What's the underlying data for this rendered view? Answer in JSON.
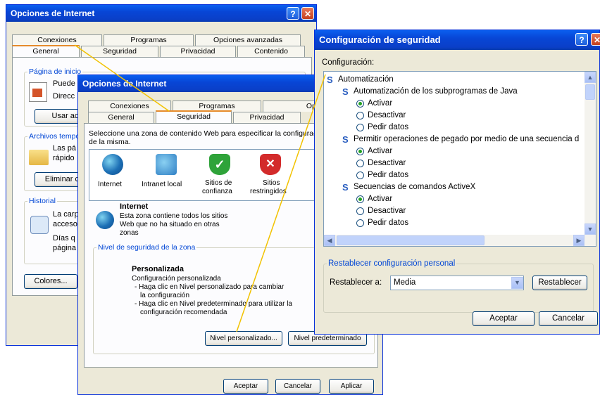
{
  "win1": {
    "title": "Opciones de Internet",
    "tabs_top": [
      "Conexiones",
      "Programas",
      "Opciones avanzadas"
    ],
    "tabs_bottom": [
      "General",
      "Seguridad",
      "Privacidad",
      "Contenido"
    ],
    "group_home": "Página de inicio",
    "home_text1": "Puede",
    "home_text2": "Direcc",
    "btn_use_current": "Usar act",
    "group_temp": "Archivos tempor",
    "temp_text1": "Las pá",
    "temp_text2": "rápido",
    "btn_delete": "Eliminar coo",
    "group_history": "Historial",
    "hist_text1": "La carp",
    "hist_text2": "acceso",
    "hist_text3": "Días q",
    "hist_text4": "página",
    "btn_colors": "Colores..."
  },
  "win2": {
    "title": "Opciones de Internet",
    "tabs_top": [
      "Conexiones",
      "Programas",
      "Opciones"
    ],
    "tabs_bottom": [
      "General",
      "Seguridad",
      "Privacidad"
    ],
    "intro": "Seleccione una zona de contenido Web para especificar la configuració",
    "intro2": "de la misma.",
    "zones": [
      {
        "label": "Internet",
        "icon": "globe-icon"
      },
      {
        "label": "Intranet local",
        "icon": "intranet-icon"
      },
      {
        "label1": "Sitios de",
        "label2": "confianza",
        "icon": "trusted-check-icon"
      },
      {
        "label1": "Sitios",
        "label2": "restringidos",
        "icon": "restricted-x-icon"
      }
    ],
    "zone_title": "Internet",
    "zone_desc1": "Esta zona contiene todos los sitios",
    "zone_desc2": "Web que no ha situado en otras",
    "zone_desc3": "zonas",
    "level_group": "Nivel de seguridad de la zona",
    "level_name": "Personalizada",
    "level_line1": "Configuración personalizada",
    "level_line2": "- Haga clic en Nivel personalizado para cambiar",
    "level_line3": "la configuración",
    "level_line4": "- Haga clic en Nivel predeterminado para utilizar la",
    "level_line5": "configuración recomendada",
    "btn_custom": "Nivel personalizado...",
    "btn_default": "Nivel predeterminado",
    "btn_ok": "Aceptar",
    "btn_cancel": "Cancelar",
    "btn_apply": "Aplicar"
  },
  "win3": {
    "title": "Configuración de seguridad",
    "config_label": "Configuración:",
    "tree": [
      {
        "type": "root",
        "text": "Automatización"
      },
      {
        "type": "section",
        "text": "Automatización de los subprogramas de Java"
      },
      {
        "type": "option",
        "text": "Activar",
        "checked": true
      },
      {
        "type": "option",
        "text": "Desactivar",
        "checked": false
      },
      {
        "type": "option",
        "text": "Pedir datos",
        "checked": false
      },
      {
        "type": "section",
        "text": "Permitir operaciones de pegado por medio de una secuencia d"
      },
      {
        "type": "option",
        "text": "Activar",
        "checked": true
      },
      {
        "type": "option",
        "text": "Desactivar",
        "checked": false
      },
      {
        "type": "option",
        "text": "Pedir datos",
        "checked": false
      },
      {
        "type": "section",
        "text": "Secuencias de comandos ActiveX"
      },
      {
        "type": "option",
        "text": "Activar",
        "checked": true
      },
      {
        "type": "option",
        "text": "Desactivar",
        "checked": false
      },
      {
        "type": "option",
        "text": "Pedir datos",
        "checked": false
      }
    ],
    "reset_group": "Restablecer configuración personal",
    "reset_label": "Restablecer a:",
    "reset_value": "Media",
    "btn_reset": "Restablecer",
    "btn_ok": "Aceptar",
    "btn_cancel": "Cancelar"
  }
}
